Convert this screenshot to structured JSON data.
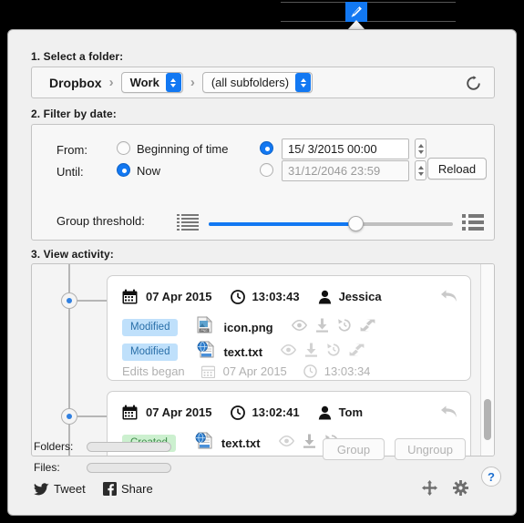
{
  "menubar": {
    "extra_icon": "pencil-icon"
  },
  "steps": {
    "folder_label": "1. Select a folder:",
    "date_label": "2. Filter by date:",
    "activity_label": "3. View activity:"
  },
  "folder": {
    "root": "Dropbox",
    "separator": "›",
    "subfolder": "Work",
    "scope": "(all subfolders)",
    "refresh_icon": "refresh-icon"
  },
  "filter": {
    "from_label": "From:",
    "until_label": "Until:",
    "from_option": "Beginning of time",
    "until_option": "Now",
    "from_date": "15/  3/2015 00:00",
    "until_date": "31/12/2046 23:59",
    "from_radio_date_selected": true,
    "until_radio_now_selected": true,
    "reload_label": "Reload",
    "threshold_label": "Group threshold:",
    "threshold_percent": 60,
    "icon_left": "list-compact-icon",
    "icon_right": "list-spaced-icon"
  },
  "activity": {
    "events": [
      {
        "date": "07 Apr 2015",
        "time": "13:03:43",
        "user": "Jessica",
        "reply_icon": "reply-arrow-icon",
        "files": [
          {
            "status": "Modified",
            "status_type": "modified",
            "icon": "png-file-icon",
            "name": "icon.png",
            "actions": [
              "eye-icon",
              "download-icon",
              "history-icon",
              "compare-icon"
            ]
          },
          {
            "status": "Modified",
            "status_type": "modified",
            "icon": "text-file-icon",
            "name": "text.txt",
            "actions": [
              "eye-icon",
              "download-icon",
              "history-icon",
              "compare-icon"
            ]
          }
        ],
        "footer": {
          "label": "Edits began",
          "date": "07 Apr 2015",
          "time": "13:03:34"
        }
      },
      {
        "date": "07 Apr 2015",
        "time": "13:02:41",
        "user": "Tom",
        "reply_icon": "reply-arrow-icon",
        "files": [
          {
            "status": "Created",
            "status_type": "created",
            "icon": "text-file-icon",
            "name": "text.txt",
            "actions": [
              "eye-icon",
              "download-icon",
              "history-icon"
            ]
          }
        ]
      }
    ]
  },
  "bottom": {
    "folders_label": "Folders:",
    "files_label": "Files:",
    "folders_progress": 0,
    "files_progress": 0,
    "group_label": "Group",
    "ungroup_label": "Ungroup",
    "help_label": "?",
    "tweet_label": "Tweet",
    "share_label": "Share",
    "tweet_icon": "twitter-bird-icon",
    "share_icon": "facebook-f-icon",
    "move_icon": "move-arrows-icon",
    "settings_icon": "gear-icon"
  },
  "colors": {
    "accent_blue": "#1278f2",
    "badge_modified_bg": "#bfe0fb",
    "badge_created_bg": "#ccf0cf",
    "panel_bg": "#f0f0f0"
  }
}
